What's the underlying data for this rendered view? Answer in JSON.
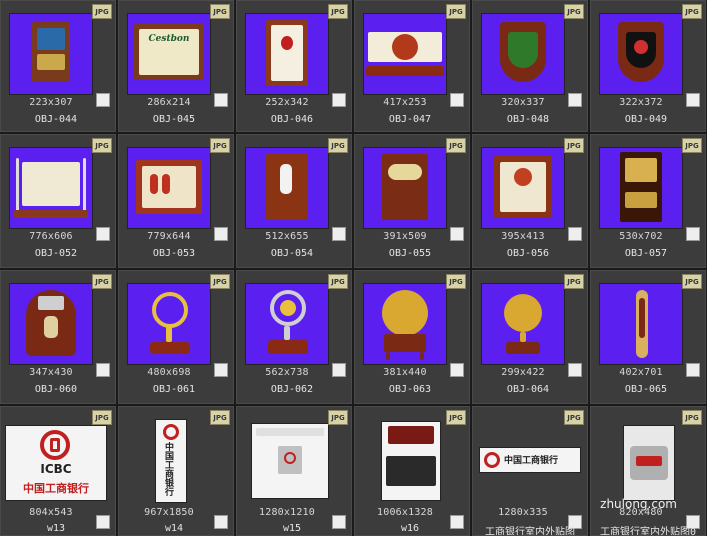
{
  "badge": "JPG",
  "items": [
    {
      "dims": "223x307",
      "name": "OBJ-044"
    },
    {
      "dims": "286x214",
      "name": "OBJ-045"
    },
    {
      "dims": "252x342",
      "name": "OBJ-046"
    },
    {
      "dims": "417x253",
      "name": "OBJ-047"
    },
    {
      "dims": "320x337",
      "name": "OBJ-048"
    },
    {
      "dims": "322x372",
      "name": "OBJ-049"
    },
    {
      "dims": "776x606",
      "name": "OBJ-052"
    },
    {
      "dims": "779x644",
      "name": "OBJ-053"
    },
    {
      "dims": "512x655",
      "name": "OBJ-054"
    },
    {
      "dims": "391x509",
      "name": "OBJ-055"
    },
    {
      "dims": "395x413",
      "name": "OBJ-056"
    },
    {
      "dims": "530x702",
      "name": "OBJ-057"
    },
    {
      "dims": "347x430",
      "name": "OBJ-060"
    },
    {
      "dims": "480x698",
      "name": "OBJ-061"
    },
    {
      "dims": "562x738",
      "name": "OBJ-062"
    },
    {
      "dims": "381x440",
      "name": "OBJ-063"
    },
    {
      "dims": "299x422",
      "name": "OBJ-064"
    },
    {
      "dims": "402x701",
      "name": "OBJ-065"
    },
    {
      "dims": "804x543",
      "name": "w13"
    },
    {
      "dims": "967x1850",
      "name": "w14"
    },
    {
      "dims": "1280x1210",
      "name": "w15"
    },
    {
      "dims": "1006x1328",
      "name": "w16"
    },
    {
      "dims": "1280x335",
      "name": "工商银行室内外贴图"
    },
    {
      "dims": "820x480",
      "name": "工商银行室内外贴图0"
    }
  ],
  "thumb_text": {
    "icbc_en": "ICBC",
    "icbc_cn": "中国工商银行",
    "plaque_text": "Cestbon"
  },
  "watermark": "zhulong.com"
}
